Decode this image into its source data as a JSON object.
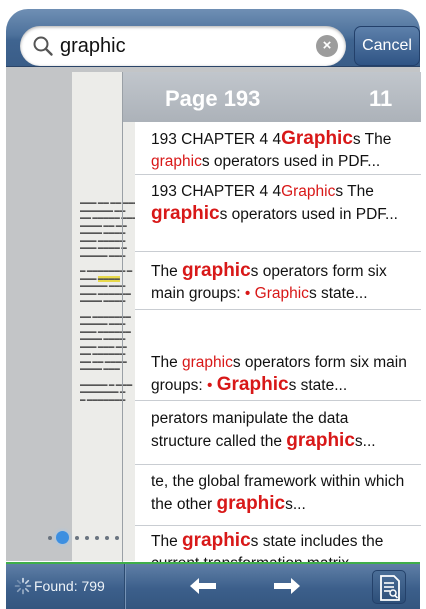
{
  "search": {
    "query": "graphic",
    "cancel_label": "Cancel"
  },
  "results_panel": {
    "title": "Page 193",
    "count": "11",
    "items": [
      {
        "segments": [
          {
            "t": "193 CHAPTER 4 4"
          },
          {
            "t": "Graphic",
            "hl": true,
            "big": true
          },
          {
            "t": "s The "
          },
          {
            "t": "graphic",
            "hl": true
          },
          {
            "t": "s operators used in PDF..."
          }
        ]
      },
      {
        "segments": [
          {
            "t": "193 CHAPTER 4 4"
          },
          {
            "t": "Graphic",
            "hl": true
          },
          {
            "t": "s The "
          },
          {
            "t": "graphic",
            "hl": true,
            "big": true
          },
          {
            "t": "s operators used in PDF..."
          }
        ]
      },
      {
        "segments": [
          {
            "t": "The "
          },
          {
            "t": "graphic",
            "hl": true,
            "big": true
          },
          {
            "t": "s operators form six main groups: "
          },
          {
            "t": "• ",
            "sep": true
          },
          {
            "t": "Graphic",
            "hl": true
          },
          {
            "t": "s state..."
          }
        ]
      },
      {
        "segments": [
          {
            "t": "The "
          },
          {
            "t": "graphic",
            "hl": true
          },
          {
            "t": "s operators form six main groups: "
          },
          {
            "t": "• ",
            "sep": true
          },
          {
            "t": "Graphic",
            "hl": true,
            "big": true
          },
          {
            "t": "s state..."
          }
        ]
      },
      {
        "segments": [
          {
            "t": "perators manipulate the data structure called the "
          },
          {
            "t": "graphic",
            "hl": true,
            "big": true
          },
          {
            "t": "s..."
          }
        ]
      },
      {
        "segments": [
          {
            "t": "te,  the global framework within which the other "
          },
          {
            "t": "graphic",
            "hl": true,
            "big": true
          },
          {
            "t": "s..."
          }
        ]
      },
      {
        "segments": [
          {
            "t": "The  "
          },
          {
            "t": "graphic",
            "hl": true,
            "big": true
          },
          {
            "t": "s state includes the current transformation matrix..."
          }
        ]
      }
    ]
  },
  "toolbar": {
    "found_label": "Found: 799"
  },
  "colors": {
    "highlight": "#d81818",
    "bar_blue": "#3f6490",
    "progress_green": "#3fae4a",
    "page_dot_active": "#3d8fe0"
  },
  "icons": {
    "search": "search-icon",
    "clear": "clear-icon",
    "spinner": "spinner-icon",
    "prev": "arrow-left-icon",
    "next": "arrow-right-icon",
    "results": "document-search-icon"
  }
}
